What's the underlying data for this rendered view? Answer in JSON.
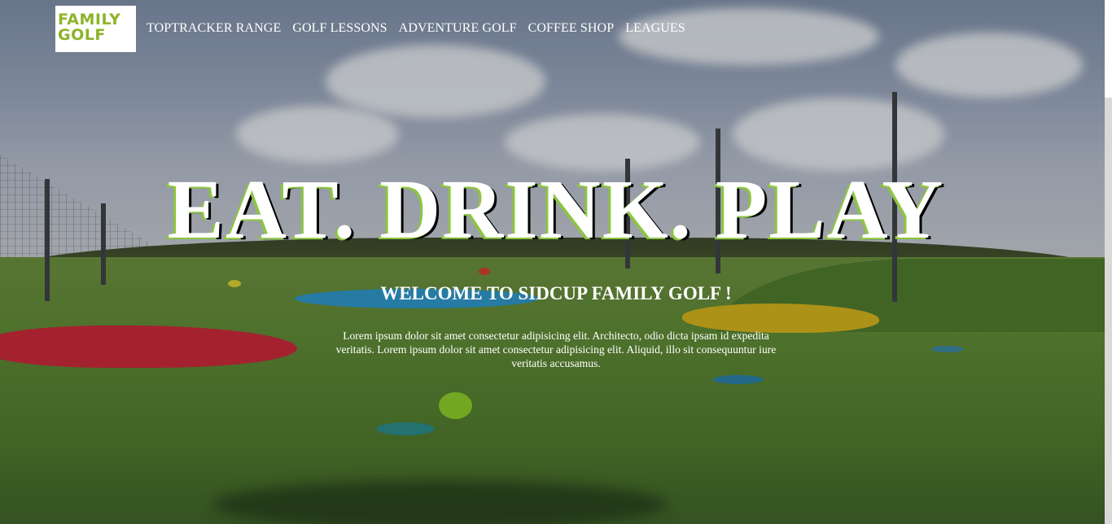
{
  "header": {
    "logo": {
      "line1": "FAMILY",
      "line2": "GOLF"
    },
    "nav": [
      {
        "label": "TOPTRACKER RANGE"
      },
      {
        "label": "GOLF LESSONS"
      },
      {
        "label": "ADVENTURE GOLF"
      },
      {
        "label": "COFFEE SHOP"
      },
      {
        "label": "LEAGUES"
      }
    ]
  },
  "hero": {
    "title": "EAT. DRINK. PLAY",
    "welcome": "WELCOME TO SIDCUP FAMILY GOLF !",
    "intro": "Lorem ipsum dolor sit amet consectetur adipisicing elit. Architecto, odio dicta ipsam id expedita veritatis. Lorem ipsum dolor sit amet consectetur adipisicing elit. Aliquid, illo sit consequuntur iure veritatis accusamus."
  },
  "colors": {
    "brand_green": "#8cc63f",
    "logo_green": "#8db32a",
    "text": "#ffffff"
  }
}
